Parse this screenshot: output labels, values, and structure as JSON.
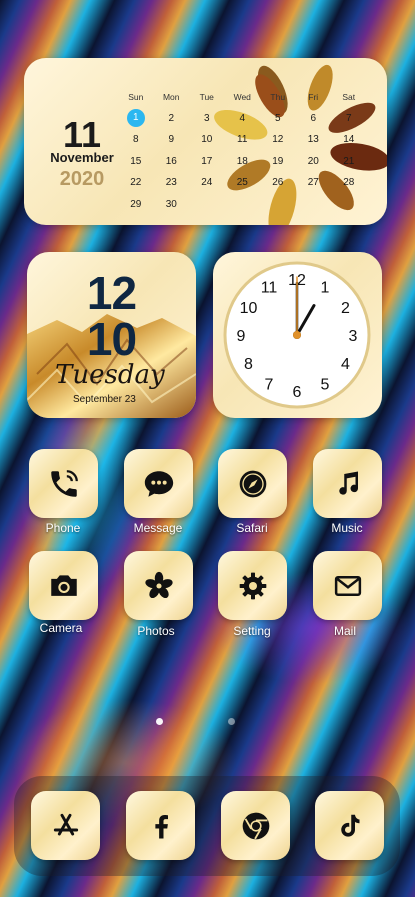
{
  "calendar": {
    "day": "11",
    "month": "November",
    "year": "2020",
    "weekdays": [
      "Sun",
      "Mon",
      "Tue",
      "Wed",
      "Thu",
      "Fri",
      "Sat"
    ],
    "weeks": [
      [
        "1",
        "2",
        "3",
        "4",
        "5",
        "6",
        "7"
      ],
      [
        "8",
        "9",
        "10",
        "11",
        "12",
        "13",
        "14"
      ],
      [
        "15",
        "16",
        "17",
        "18",
        "19",
        "20",
        "21"
      ],
      [
        "22",
        "23",
        "24",
        "25",
        "26",
        "27",
        "28"
      ],
      [
        "29",
        "30",
        "",
        "",
        "",
        "",
        ""
      ]
    ],
    "highlight_color": "#2bb7f0"
  },
  "date_widget": {
    "hour": "12",
    "minute": "10",
    "weekday": "Tuesday",
    "date": "September 23"
  },
  "clock": {
    "numbers": [
      "12",
      "1",
      "2",
      "3",
      "4",
      "5",
      "6",
      "7",
      "8",
      "9",
      "10",
      "11"
    ],
    "hour": 1,
    "minute": 0,
    "second": 0
  },
  "apps": [
    {
      "label": "Phone",
      "icon": "phone-icon"
    },
    {
      "label": "Message",
      "icon": "message-icon"
    },
    {
      "label": "Safari",
      "icon": "compass-icon"
    },
    {
      "label": "Music",
      "icon": "music-icon"
    },
    {
      "label": "Camera",
      "icon": "camera-icon"
    },
    {
      "label": "Photos",
      "icon": "pinwheel-icon"
    },
    {
      "label": "Setting",
      "icon": "gear-icon"
    },
    {
      "label": "Mail",
      "icon": "mail-icon"
    }
  ],
  "dock": [
    {
      "icon": "app-store-icon"
    },
    {
      "icon": "facebook-icon"
    },
    {
      "icon": "chrome-icon"
    },
    {
      "icon": "tiktok-icon"
    }
  ],
  "page_indicator": {
    "pages": 2,
    "current": 1
  }
}
